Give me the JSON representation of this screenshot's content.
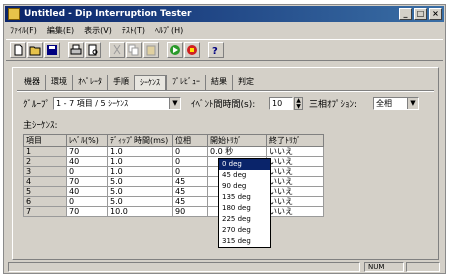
{
  "window": {
    "title": "Untitled - Dip Interruption Tester",
    "buttons": [
      "_",
      "□",
      "×"
    ]
  },
  "menu": [
    "ﾌｧｲﾙ(F)",
    "編集(E)",
    "表示(V)",
    "ﾃｽﾄ(T)",
    "ﾍﾙﾌﾟ(H)"
  ],
  "toolbar": [
    "new-file-icon",
    "open-folder-icon",
    "save-icon",
    "print-icon",
    "print-preview-icon",
    "cut-icon",
    "copy-icon",
    "paste-icon",
    "run-icon",
    "stop-icon",
    "help-icon"
  ],
  "tabs": [
    "機器",
    "環境",
    "ｵﾍﾟﾚｰﾀ",
    "手順",
    "ｼｰｹﾝｽ",
    "ﾌﾟﾚﾋﾞｭｰ",
    "結果",
    "判定"
  ],
  "active_tab": 4,
  "form": {
    "group_label": "ｸﾞﾙｰﾌﾟ",
    "group_value": "1 - 7 項目 / 5 ｼｰｹﾝｽ",
    "interval_label": "ｲﾍﾞﾝﾄ間時間(s):",
    "interval_value": "10",
    "phase_label": "三相ｵﾌﾟｼｮﾝ:",
    "phase_value": "全相",
    "main_seq_label": "主ｼｰｹﾝｽ:"
  },
  "table": {
    "headers": [
      "項目",
      "ﾚﾍﾞﾙ(%)",
      "ﾃﾞｨｯﾌﾟ時間(ms)",
      "位相",
      "開始ﾄﾘｶﾞ",
      "終了ﾄﾘｶﾞ"
    ],
    "rows": [
      [
        "1",
        "70",
        "1.0",
        "0",
        "0.0 秒",
        "いいえ"
      ],
      [
        "2",
        "40",
        "1.0",
        "0",
        "",
        "いいえ"
      ],
      [
        "3",
        "0",
        "1.0",
        "0",
        "",
        "いいえ"
      ],
      [
        "4",
        "70",
        "5.0",
        "45",
        "",
        "いいえ"
      ],
      [
        "5",
        "40",
        "5.0",
        "45",
        "",
        "いいえ"
      ],
      [
        "6",
        "0",
        "5.0",
        "45",
        "",
        "いいえ"
      ],
      [
        "7",
        "70",
        "10.0",
        "90",
        "",
        "いいえ"
      ]
    ]
  },
  "dropdown": {
    "options": [
      "0 deg",
      "45 deg",
      "90 deg",
      "135 deg",
      "180 deg",
      "225 deg",
      "270 deg",
      "315 deg"
    ],
    "selected": 0
  },
  "status": {
    "indicator": "NUM"
  }
}
